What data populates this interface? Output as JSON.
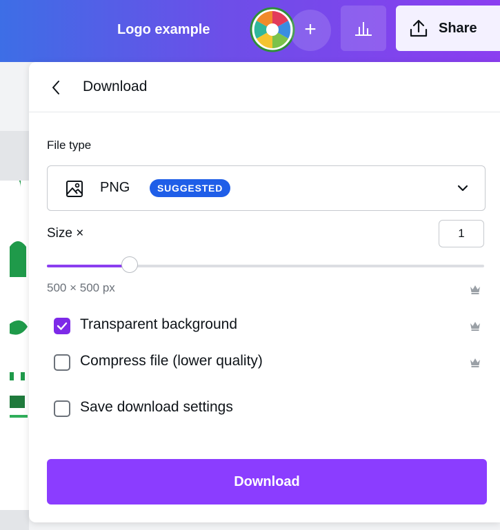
{
  "topbar": {
    "design_title": "Logo example",
    "add_symbol": "+",
    "share_label": "Share"
  },
  "panel": {
    "title": "Download",
    "file_type_label": "File type",
    "file_type_value": "PNG",
    "file_type_badge": "SUGGESTED",
    "size_label": "Size ×",
    "size_value": "1",
    "size_slider_fraction": 0.19,
    "dimensions": "500 × 500 px",
    "options": [
      {
        "label": "Transparent background",
        "checked": true,
        "premium": true
      },
      {
        "label": "Compress file (lower quality)",
        "checked": false,
        "premium": true
      },
      {
        "label": "Save download settings",
        "checked": false,
        "premium": false
      }
    ],
    "download_label": "Download"
  },
  "colors": {
    "accent": "#8b3dff",
    "badge": "#1f5ee8",
    "checkbox_checked": "#7d2ae8",
    "topbar_gradient_start": "#3d6ee6",
    "topbar_gradient_end": "#8b3ef0"
  },
  "icons": [
    "app-logo-icon",
    "plus-icon",
    "bar-chart-icon",
    "upload-icon",
    "back-chevron-icon",
    "image-icon",
    "chevron-down-icon",
    "crown-icon",
    "check-icon"
  ]
}
